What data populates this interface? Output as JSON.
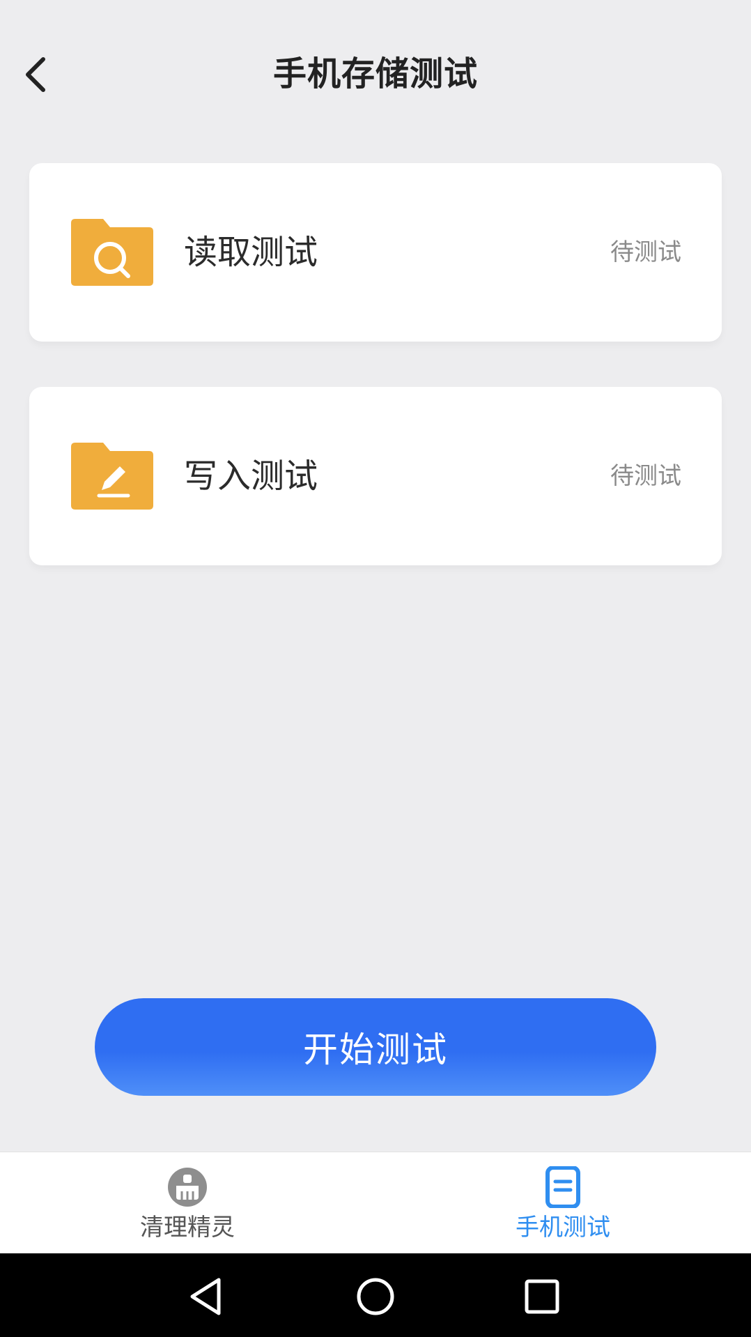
{
  "header": {
    "title": "手机存储测试",
    "back_icon": "chevron-left-icon"
  },
  "tests": [
    {
      "label": "读取测试",
      "status": "待测试",
      "icon": "folder-search-icon"
    },
    {
      "label": "写入测试",
      "status": "待测试",
      "icon": "folder-edit-icon"
    }
  ],
  "start_button": {
    "label": "开始测试"
  },
  "tabbar": {
    "items": [
      {
        "label": "清理精灵",
        "icon": "broom-icon",
        "active": false
      },
      {
        "label": "手机测试",
        "icon": "document-icon",
        "active": true
      }
    ]
  },
  "system_nav": {
    "icons": [
      "nav-back-icon",
      "nav-home-icon",
      "nav-recent-icon"
    ]
  },
  "colors": {
    "background": "#ededef",
    "card": "#ffffff",
    "folder": "#f0ad3c",
    "primary": "#2f6ef2",
    "tab_active": "#2f8ef0",
    "tab_inactive": "#555555",
    "status_text": "#8a8a8a"
  }
}
